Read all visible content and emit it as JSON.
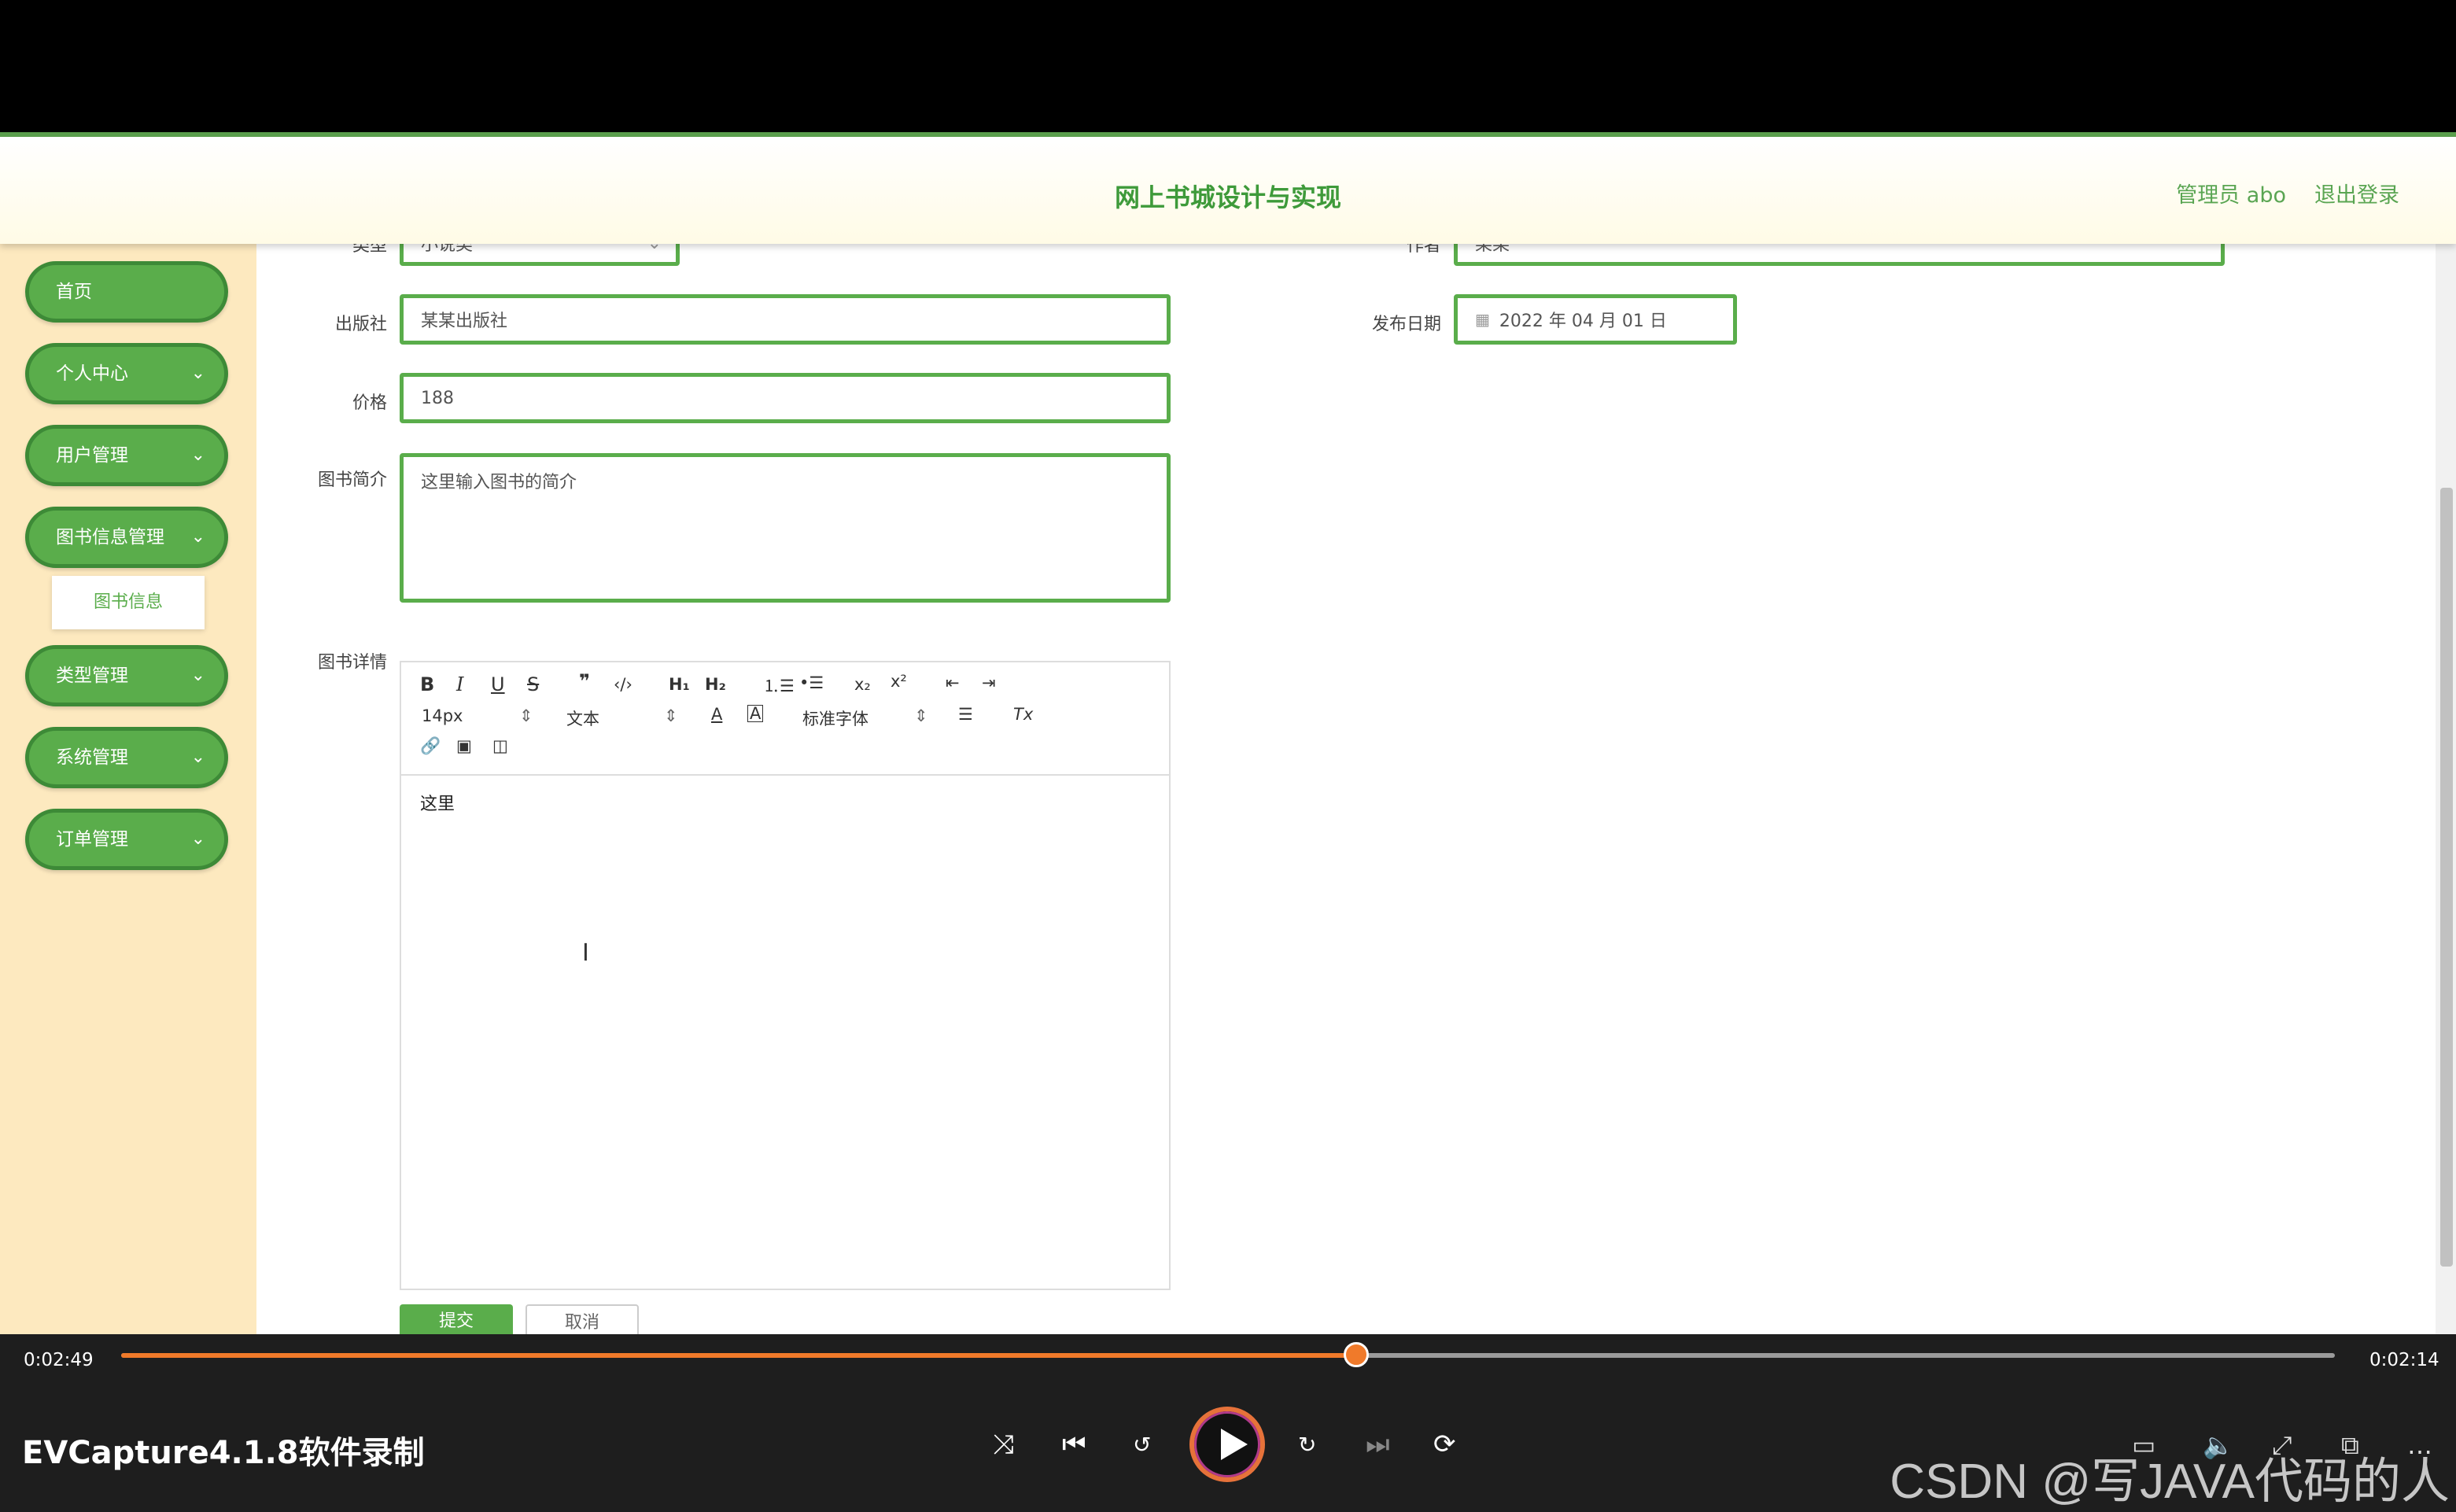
{
  "app": {
    "title": "网上书城设计与实现",
    "admin_label": "管理员 abo",
    "logout": "退出登录"
  },
  "sidebar": {
    "items": [
      {
        "label": "首页"
      },
      {
        "label": "个人中心"
      },
      {
        "label": "用户管理"
      },
      {
        "label": "图书信息管理"
      },
      {
        "label": "类型管理"
      },
      {
        "label": "系统管理"
      },
      {
        "label": "订单管理"
      }
    ],
    "sub_item": "图书信息"
  },
  "form": {
    "type_label": "类型",
    "type_value": "小说类",
    "author_label": "作者",
    "author_value": "某某",
    "publisher_label": "出版社",
    "publisher_value": "某某出版社",
    "date_label": "发布日期",
    "date_value": "2022 年 04 月 01 日",
    "price_label": "价格",
    "price_value": "188",
    "intro_label": "图书简介",
    "intro_value": "这里输入图书的简介",
    "detail_label": "图书详情",
    "editor": {
      "font_size": "14px",
      "text_style": "文本",
      "font_family": "标准字体",
      "content": "这里"
    },
    "submit": "提交",
    "cancel": "取消"
  },
  "player": {
    "elapsed": "0:02:49",
    "remaining": "0:02:14",
    "progress": 0.558,
    "recorder": "EVCapture4.1.8软件录制",
    "watermark": "CSDN @写JAVA代码的人"
  },
  "colors": {
    "accent": "#5aad4b",
    "sidebar_bg": "#fde9bf",
    "progress": "#f07a2a"
  }
}
